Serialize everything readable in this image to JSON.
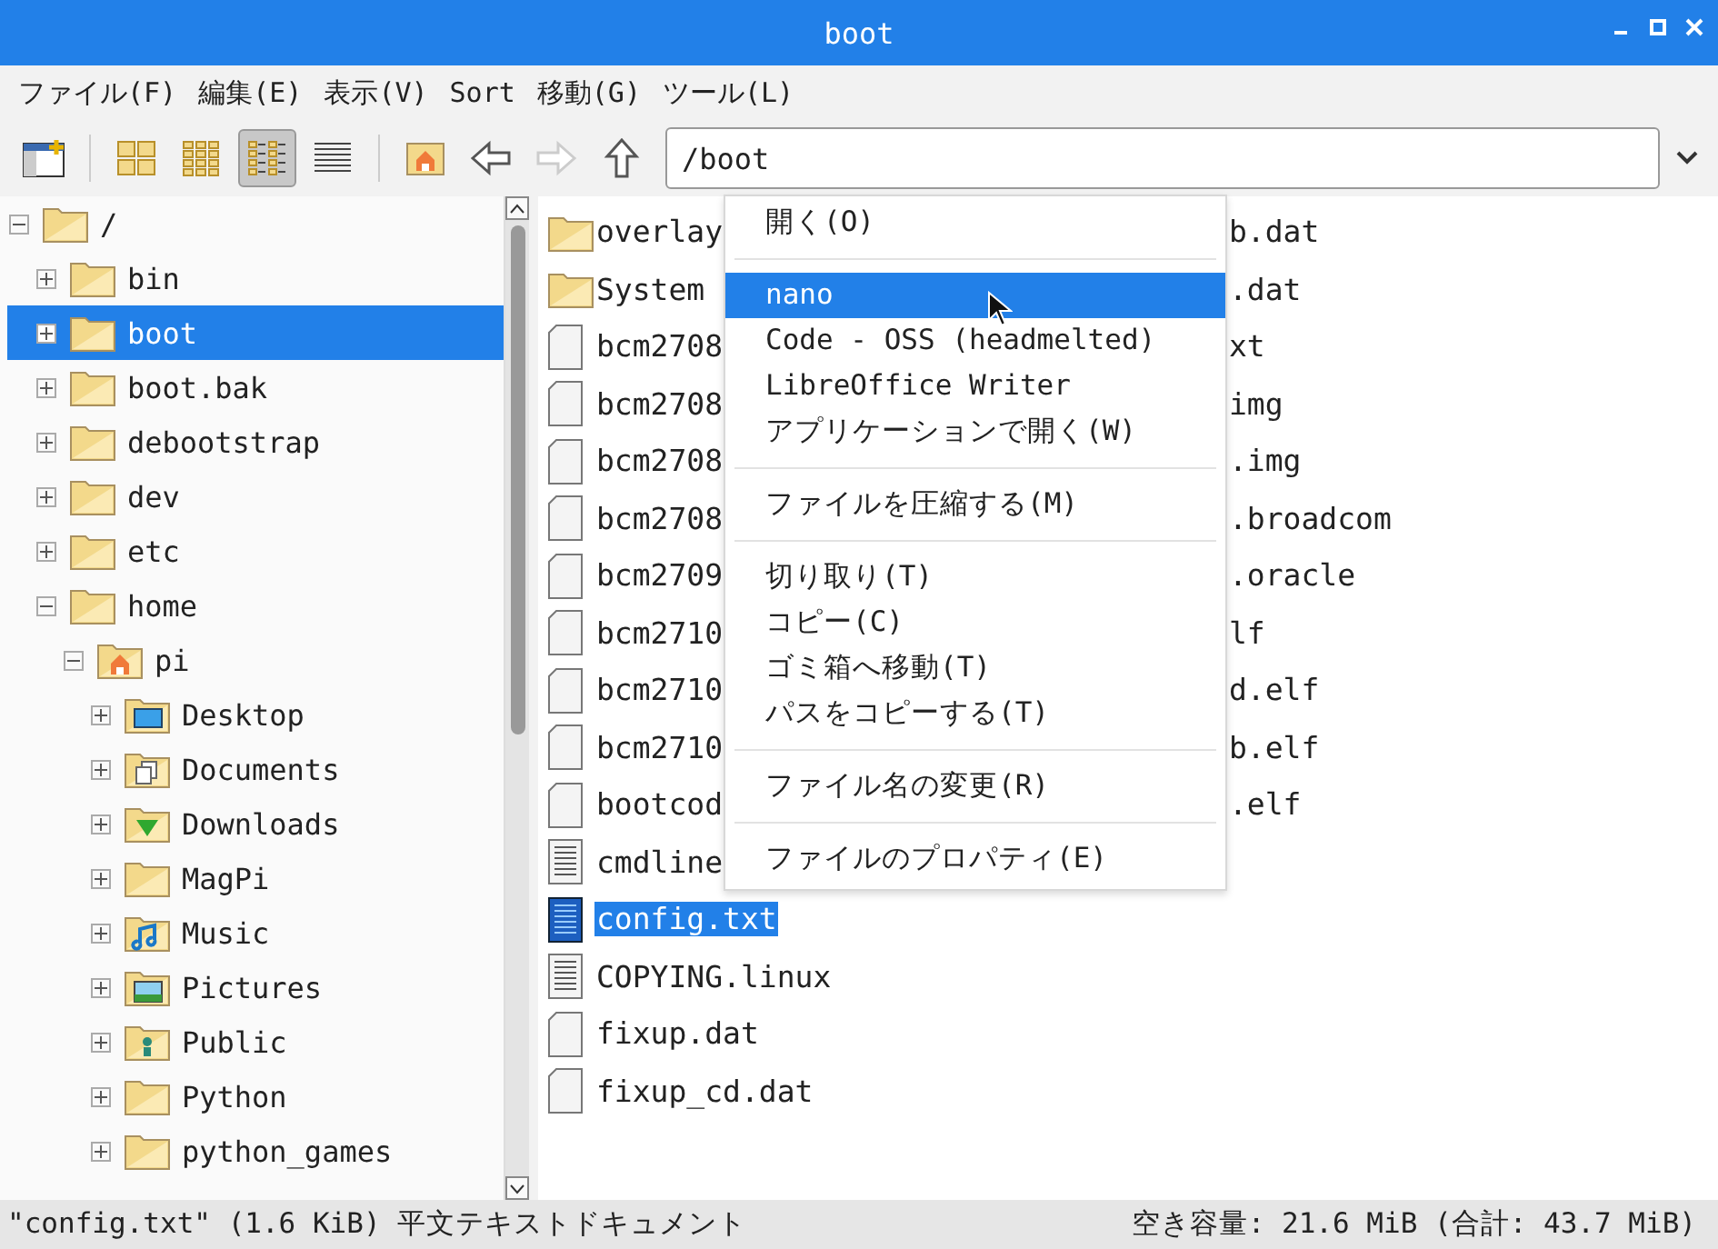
{
  "window": {
    "title": "boot"
  },
  "menubar": [
    "ファイル(F)",
    "編集(E)",
    "表示(V)",
    "Sort",
    "移動(G)",
    "ツール(L)"
  ],
  "toolbar": {
    "views": [
      {
        "kind": "icons",
        "selected": false
      },
      {
        "kind": "thumbnails",
        "selected": false
      },
      {
        "kind": "compact",
        "selected": true
      },
      {
        "kind": "list",
        "selected": false
      }
    ],
    "nav": [
      {
        "kind": "home",
        "disabled": false
      },
      {
        "kind": "back",
        "disabled": false
      },
      {
        "kind": "forward",
        "disabled": true
      },
      {
        "kind": "up",
        "disabled": false
      }
    ],
    "location": "/boot"
  },
  "tree": [
    {
      "label": "/",
      "kind": "folder",
      "expanded": true,
      "selected": false,
      "children": [
        {
          "label": "bin",
          "kind": "folder",
          "expanded": false,
          "selected": false
        },
        {
          "label": "boot",
          "kind": "folder",
          "expanded": false,
          "selected": true
        },
        {
          "label": "boot.bak",
          "kind": "folder",
          "expanded": false,
          "selected": false
        },
        {
          "label": "debootstrap",
          "kind": "folder",
          "expanded": false,
          "selected": false
        },
        {
          "label": "dev",
          "kind": "folder",
          "expanded": false,
          "selected": false
        },
        {
          "label": "etc",
          "kind": "folder",
          "expanded": false,
          "selected": false
        },
        {
          "label": "home",
          "kind": "folder",
          "expanded": true,
          "selected": false,
          "children": [
            {
              "label": "pi",
              "kind": "home",
              "expanded": true,
              "selected": false,
              "children": [
                {
                  "label": "Desktop",
                  "kind": "desktop",
                  "expanded": false,
                  "selected": false
                },
                {
                  "label": "Documents",
                  "kind": "documents",
                  "expanded": false,
                  "selected": false
                },
                {
                  "label": "Downloads",
                  "kind": "downloads",
                  "expanded": false,
                  "selected": false
                },
                {
                  "label": "MagPi",
                  "kind": "folder",
                  "expanded": false,
                  "selected": false
                },
                {
                  "label": "Music",
                  "kind": "music",
                  "expanded": false,
                  "selected": false
                },
                {
                  "label": "Pictures",
                  "kind": "pictures",
                  "expanded": false,
                  "selected": false
                },
                {
                  "label": "Public",
                  "kind": "public",
                  "expanded": false,
                  "selected": false
                },
                {
                  "label": "Python",
                  "kind": "folder",
                  "expanded": false,
                  "selected": false
                },
                {
                  "label": "python_games",
                  "kind": "folder",
                  "expanded": false,
                  "selected": false
                }
              ]
            }
          ]
        }
      ]
    }
  ],
  "files": [
    {
      "kind": "folder",
      "name": "overlay",
      "name_right": "b.dat",
      "selected": false
    },
    {
      "kind": "folder",
      "name": "System",
      "name_right": ".dat",
      "selected": false
    },
    {
      "kind": "file",
      "name": "bcm2708",
      "name_right": "xt",
      "selected": false
    },
    {
      "kind": "file",
      "name": "bcm2708",
      "name_right": "img",
      "selected": false
    },
    {
      "kind": "file",
      "name": "bcm2708",
      "name_right": ".img",
      "selected": false
    },
    {
      "kind": "file",
      "name": "bcm2708",
      "name_right": ".broadcom",
      "selected": false
    },
    {
      "kind": "file",
      "name": "bcm2709",
      "name_right": ".oracle",
      "selected": false
    },
    {
      "kind": "file",
      "name": "bcm2710",
      "name_right": "lf",
      "selected": false
    },
    {
      "kind": "file",
      "name": "bcm2710",
      "name_right": "d.elf",
      "selected": false
    },
    {
      "kind": "file",
      "name": "bcm2710",
      "name_right": "b.elf",
      "selected": false
    },
    {
      "kind": "file",
      "name": "bootcod",
      "name_right": ".elf",
      "selected": false
    },
    {
      "kind": "text",
      "name": "cmdline",
      "selected": false
    },
    {
      "kind": "text",
      "name": "config.txt",
      "selected": true
    },
    {
      "kind": "text",
      "name": "COPYING.linux",
      "selected": false
    },
    {
      "kind": "file",
      "name": "fixup.dat",
      "selected": false
    },
    {
      "kind": "file",
      "name": "fixup_cd.dat",
      "selected": false
    }
  ],
  "context_menu": [
    [
      {
        "label": "開く(O)",
        "selected": false
      }
    ],
    [
      {
        "label": "nano",
        "selected": true
      },
      {
        "label": "Code - OSS (headmelted)",
        "selected": false
      },
      {
        "label": "LibreOffice Writer",
        "selected": false
      },
      {
        "label": "アプリケーションで開く(W)",
        "selected": false
      }
    ],
    [
      {
        "label": "ファイルを圧縮する(M)",
        "selected": false
      }
    ],
    [
      {
        "label": "切り取り(T)",
        "selected": false
      },
      {
        "label": "コピー(C)",
        "selected": false
      },
      {
        "label": "ゴミ箱へ移動(T)",
        "selected": false
      },
      {
        "label": "パスをコピーする(T)",
        "selected": false
      }
    ],
    [
      {
        "label": "ファイル名の変更(R)",
        "selected": false
      }
    ],
    [
      {
        "label": "ファイルのプロパティ(E)",
        "selected": false
      }
    ]
  ],
  "status_bar": {
    "selection": "\"config.txt\" (1.6 KiB) 平文テキストドキュメント",
    "free_space": "空き容量: 21.6 MiB (合計: 43.7 MiB)"
  }
}
